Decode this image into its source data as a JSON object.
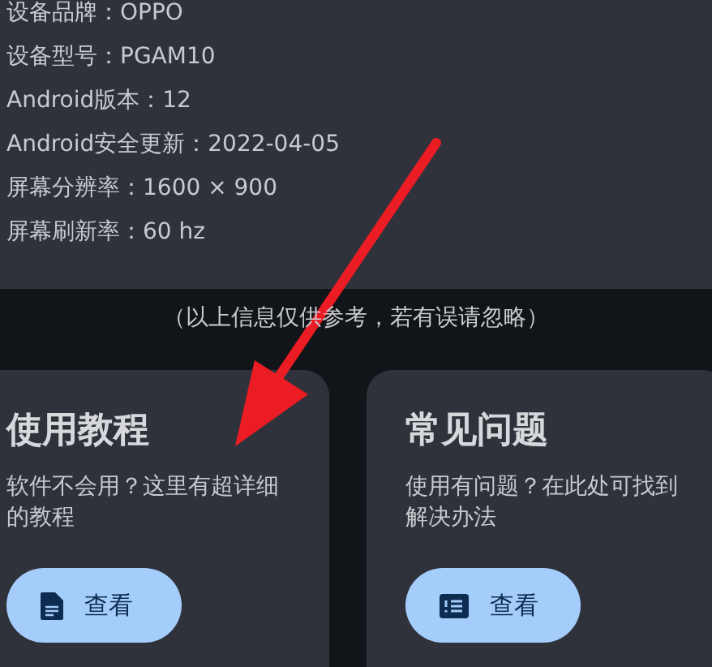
{
  "device_info": [
    "设备品牌：OPPO",
    "设备型号：PGAM10",
    "Android版本：12",
    "Android安全更新：2022-04-05",
    "屏幕分辨率：1600 × 900",
    "屏幕刷新率：60 hz"
  ],
  "note": "（以上信息仅供参考，若有误请忽略）",
  "cards": [
    {
      "title": "使用教程",
      "description": "软件不会用？这里有超详细的教程",
      "button": {
        "label": "查看"
      }
    },
    {
      "title": "常见问题",
      "description": "使用有问题？在此处可找到解决办法",
      "button": {
        "label": "查看"
      }
    }
  ]
}
